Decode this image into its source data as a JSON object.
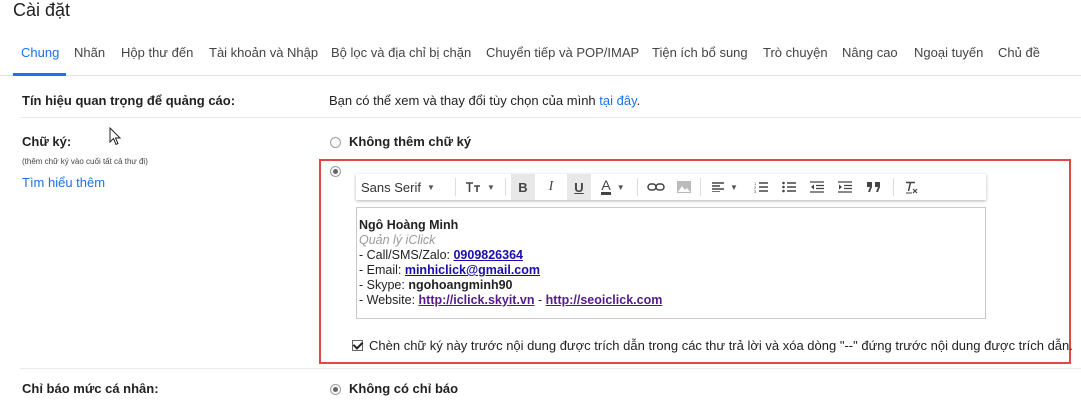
{
  "page": {
    "title": "Cài đặt"
  },
  "tabs": [
    "Chung",
    "Nhãn",
    "Hộp thư đến",
    "Tài khoản và Nhập",
    "Bộ lọc và địa chỉ bị chặn",
    "Chuyển tiếp và POP/IMAP",
    "Tiện ích bổ sung",
    "Trò chuyện",
    "Nâng cao",
    "Ngoại tuyến",
    "Chủ đề"
  ],
  "ads_row": {
    "label": "Tín hiệu quan trọng để quảng cáo:",
    "text": "Bạn có thể xem và thay đổi tùy chọn của mình",
    "link": "tại đây",
    "suffix": "."
  },
  "signature_row": {
    "label": "Chữ ký:",
    "note": "(thêm chữ ký vào cuối tất cả thư đi)",
    "learn_more": "Tìm hiểu thêm",
    "no_signature": "Không thêm chữ ký",
    "toolbar": {
      "font": "Sans Serif",
      "bold": "B",
      "italic": "I",
      "underline": "U",
      "text_color": "A"
    },
    "signature": {
      "name": "Ngô Hoàng Minh",
      "role": "Quản lý iClick",
      "phone_prefix": "- Call/SMS/Zalo: ",
      "phone": "0909826364",
      "email_prefix": "- Email: ",
      "email": "minhiclick@gmail.com",
      "skype_prefix": "- Skype: ",
      "skype": "ngohoangminh90",
      "website_prefix": "- Website: ",
      "website1": "http://iclick.skyit.vn",
      "website_sep": " - ",
      "website2": "http://seoiclick.com"
    },
    "insert_option": "Chèn chữ ký này trước nội dung được trích dẫn trong các thư trả lời và xóa dòng \"--\" đứng trước nội dung được trích dẫn."
  },
  "personal_row": {
    "label": "Chỉ báo mức cá nhân:",
    "option": "Không có chỉ báo"
  },
  "colors": {
    "accent": "#1a73e8",
    "highlight": "#e04848"
  }
}
